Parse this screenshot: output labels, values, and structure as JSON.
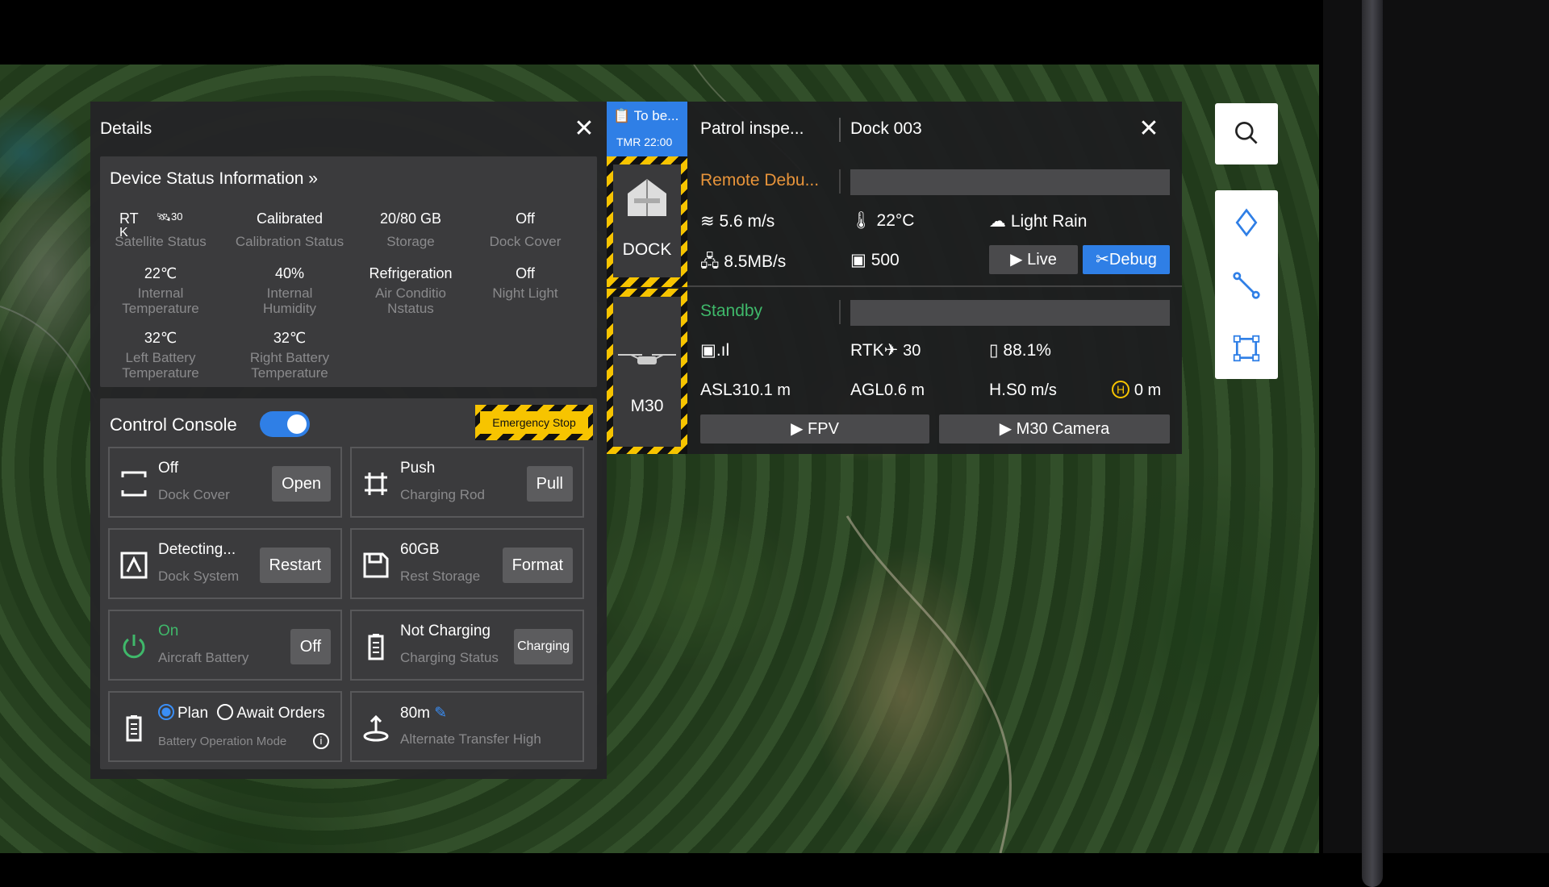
{
  "details": {
    "title": "Details",
    "device_status": {
      "title": "Device Status Information »",
      "items": [
        {
          "value": "RT",
          "value2": "K",
          "sat": "30",
          "label": "Satellite Status"
        },
        {
          "value": "Calibrated",
          "label": "Calibration Status"
        },
        {
          "value": "20/80 GB",
          "label": "Storage"
        },
        {
          "value": "Off",
          "label": "Dock Cover"
        },
        {
          "value": "22℃",
          "label": "Internal Temperature"
        },
        {
          "value": "40%",
          "label": "Internal Humidity"
        },
        {
          "value": "Refrigeration",
          "label": "Air Conditio Nstatus"
        },
        {
          "value": "Off",
          "label": "Night Light"
        },
        {
          "value": "32℃",
          "label": "Left Battery Temperature"
        },
        {
          "value": "32℃",
          "label": "Right Battery Temperature"
        }
      ]
    },
    "control_console": {
      "title": "Control Console",
      "toggle_on": true,
      "emergency_stop": "Emergency Stop",
      "cards": [
        {
          "value": "Off",
          "label": "Dock Cover",
          "button": "Open"
        },
        {
          "value": "Push",
          "label": "Charging Rod",
          "button": "Pull"
        },
        {
          "value": "Detecting...",
          "label": "Dock System",
          "button": "Restart"
        },
        {
          "value": "60GB",
          "label": "Rest Storage",
          "button": "Format"
        },
        {
          "value": "On",
          "label": "Aircraft Battery",
          "button": "Off"
        },
        {
          "value": "Not Charging",
          "label": "Charging Status",
          "button": "Charging"
        },
        {
          "option_plan": "Plan",
          "option_await": "Await Orders",
          "label": "Battery Operation Mode"
        },
        {
          "value": "80m",
          "label": "Alternate Transfer High"
        }
      ]
    }
  },
  "task": {
    "tag_line1": "To be...",
    "tag_line2": "TMR 22:00",
    "name": "Patrol inspe...",
    "dock_name": "Dock 003",
    "dock": {
      "label": "DOCK",
      "status": "Remote Debu...",
      "wind": "5.6 m/s",
      "temperature": "22°C",
      "weather": "Light Rain",
      "network": "8.5MB/s",
      "count": "500",
      "live_button": "Live",
      "debug_button": "Debug"
    },
    "drone": {
      "label": "M30",
      "status": "Standby",
      "rtk_label": "RTK",
      "rtk_value": "30",
      "battery": "88.1%",
      "asl_label": "ASL",
      "asl_value": "310.1 m",
      "agl_label": "AGL",
      "agl_value": "0.6 m",
      "hs_label": "H.S",
      "hs_value": "0 m/s",
      "home_label": "H",
      "home_value": "0 m",
      "fpv_button": "FPV",
      "camera_button": "M30 Camera"
    }
  },
  "colors": {
    "accent": "#2f7fe6",
    "warning": "#f7c400",
    "remote_status": "#e8943a",
    "standby": "#3fb86a"
  }
}
